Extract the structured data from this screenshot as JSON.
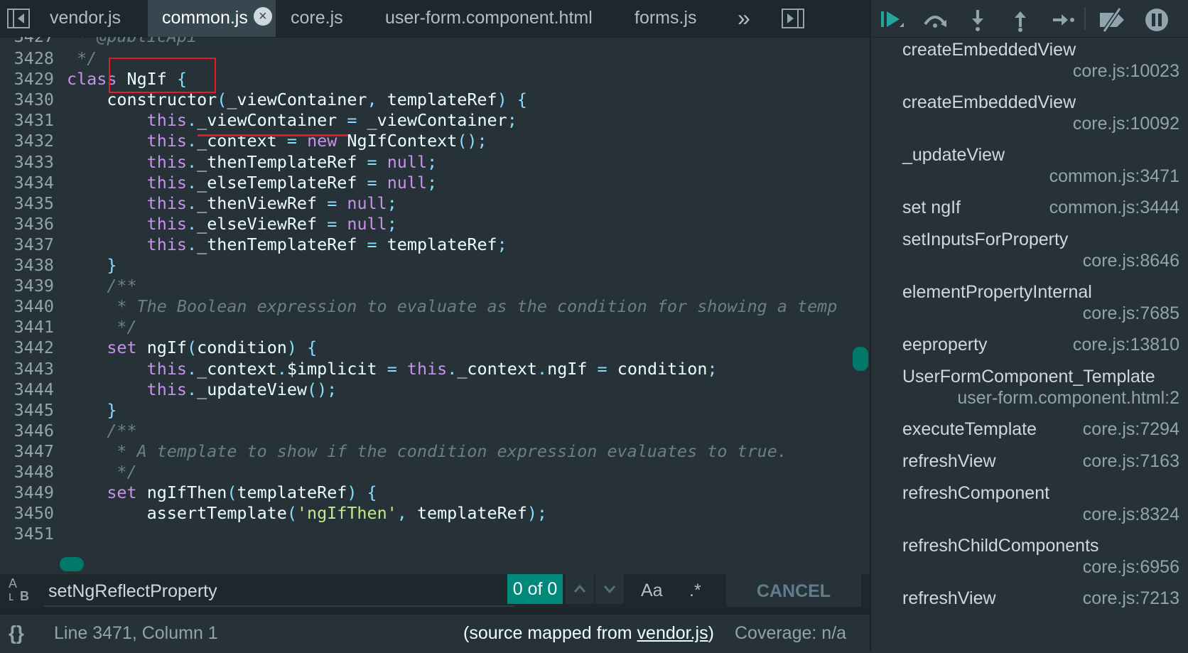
{
  "tabs": [
    {
      "label": "vendor.js",
      "active": false
    },
    {
      "label": "common.js",
      "active": true
    },
    {
      "label": "core.js",
      "active": false
    },
    {
      "label": "user-form.component.html",
      "active": false
    },
    {
      "label": "forms.js",
      "active": false
    }
  ],
  "tab_close_glyph": "×",
  "tab_overflow_glyph": "»",
  "code_lines": [
    {
      "num": "3428",
      "html": "<span class='c'> */</span>"
    },
    {
      "num": "3429",
      "html": "<span class='k'>class</span> <span class='f'>NgIf</span> <span class='p'>{</span>"
    },
    {
      "num": "3430",
      "html": "    <span class='f'>constructor</span><span class='p'>(</span><span class='f'>_viewContainer</span><span class='p'>,</span> <span class='f'>templateRef</span><span class='p'>)</span> <span class='p'>{</span>"
    },
    {
      "num": "3431",
      "html": "        <span class='k'>this</span><span class='p'>.</span><span class='f'>_viewContainer</span> <span class='p'>=</span> <span class='f'>_viewContainer</span><span class='p'>;</span>"
    },
    {
      "num": "3432",
      "html": "        <span class='k'>this</span><span class='p'>.</span><span class='f'>_context</span> <span class='p'>=</span> <span class='k'>new</span> <span class='f'>NgIfContext</span><span class='p'>();</span>"
    },
    {
      "num": "3433",
      "html": "        <span class='k'>this</span><span class='p'>.</span><span class='f'>_thenTemplateRef</span> <span class='p'>=</span> <span class='k'>null</span><span class='p'>;</span>"
    },
    {
      "num": "3434",
      "html": "        <span class='k'>this</span><span class='p'>.</span><span class='f'>_elseTemplateRef</span> <span class='p'>=</span> <span class='k'>null</span><span class='p'>;</span>"
    },
    {
      "num": "3435",
      "html": "        <span class='k'>this</span><span class='p'>.</span><span class='f'>_thenViewRef</span> <span class='p'>=</span> <span class='k'>null</span><span class='p'>;</span>"
    },
    {
      "num": "3436",
      "html": "        <span class='k'>this</span><span class='p'>.</span><span class='f'>_elseViewRef</span> <span class='p'>=</span> <span class='k'>null</span><span class='p'>;</span>"
    },
    {
      "num": "3437",
      "html": "        <span class='k'>this</span><span class='p'>.</span><span class='f'>_thenTemplateRef</span> <span class='p'>=</span> <span class='f'>templateRef</span><span class='p'>;</span>"
    },
    {
      "num": "3438",
      "html": "    <span class='p'>}</span>"
    },
    {
      "num": "3439",
      "html": "    <span class='c'>/**</span>"
    },
    {
      "num": "3440",
      "html": "<span class='c'>     * The Boolean expression to evaluate as the condition for showing a temp</span>"
    },
    {
      "num": "3441",
      "html": "<span class='c'>     */</span>"
    },
    {
      "num": "3442",
      "html": "    <span class='k'>set</span> <span class='f'>ngIf</span><span class='p'>(</span><span class='f'>condition</span><span class='p'>)</span> <span class='p'>{</span>"
    },
    {
      "num": "3443",
      "html": "        <span class='k'>this</span><span class='p'>.</span><span class='f'>_context</span><span class='p'>.</span><span class='f'>$implicit</span> <span class='p'>=</span> <span class='k'>this</span><span class='p'>.</span><span class='f'>_context</span><span class='p'>.</span><span class='f'>ngIf</span> <span class='p'>=</span> <span class='f'>condition</span><span class='p'>;</span>"
    },
    {
      "num": "3444",
      "html": "        <span class='k'>this</span><span class='p'>.</span><span class='f'>_updateView</span><span class='p'>();</span>"
    },
    {
      "num": "3445",
      "html": "    <span class='p'>}</span>"
    },
    {
      "num": "3446",
      "html": "    <span class='c'>/**</span>"
    },
    {
      "num": "3447",
      "html": "<span class='c'>     * A template to show if the condition expression evaluates to true.</span>"
    },
    {
      "num": "3448",
      "html": "<span class='c'>     */</span>"
    },
    {
      "num": "3449",
      "html": "    <span class='k'>set</span> <span class='f'>ngIfThen</span><span class='p'>(</span><span class='f'>templateRef</span><span class='p'>)</span> <span class='p'>{</span>"
    },
    {
      "num": "3450",
      "html": "        <span class='f'>assertTemplate</span><span class='p'>(</span><span class='s'>'ngIfThen'</span><span class='p'>,</span> <span class='f'>templateRef</span><span class='p'>);</span>"
    },
    {
      "num": "3451",
      "html": ""
    }
  ],
  "search": {
    "value": "setNgReflectProperty",
    "match_count": "0 of 0",
    "case_label": "Aa",
    "regex_label": ".*",
    "cancel_label": "CANCEL"
  },
  "status": {
    "braces": "{}",
    "position": "Line 3471, Column 1",
    "mapped_prefix": "(source mapped from ",
    "mapped_file": "vendor.js",
    "mapped_suffix": ")",
    "coverage": "Coverage: n/a"
  },
  "call_stack": [
    {
      "fn": "createEmbeddedView",
      "loc": "core.js:10023",
      "inline": false
    },
    {
      "fn": "createEmbeddedView",
      "loc": "core.js:10092",
      "inline": false
    },
    {
      "fn": "_updateView",
      "loc": "common.js:3471",
      "inline": false
    },
    {
      "fn": "set ngIf",
      "loc": "common.js:3444",
      "inline": true
    },
    {
      "fn": "setInputsForProperty",
      "loc": "core.js:8646",
      "inline": false
    },
    {
      "fn": "elementPropertyInternal",
      "loc": "core.js:7685",
      "inline": false
    },
    {
      "fn": "eeproperty",
      "loc": "core.js:13810",
      "inline": true
    },
    {
      "fn": "UserFormComponent_Template",
      "loc": "user-form.component.html:2",
      "inline": false
    },
    {
      "fn": "executeTemplate",
      "loc": "core.js:7294",
      "inline": true
    },
    {
      "fn": "refreshView",
      "loc": "core.js:7163",
      "inline": true
    },
    {
      "fn": "refreshComponent",
      "loc": "core.js:8324",
      "inline": false
    },
    {
      "fn": "refreshChildComponents",
      "loc": "core.js:6956",
      "inline": false
    },
    {
      "fn": "refreshView",
      "loc": "core.js:7213",
      "inline": true
    }
  ],
  "debug_icons": [
    "resume-icon",
    "step-over-icon",
    "step-into-icon",
    "step-out-icon",
    "step-icon",
    "deactivate-breakpoints-icon",
    "pause-on-exceptions-icon"
  ]
}
